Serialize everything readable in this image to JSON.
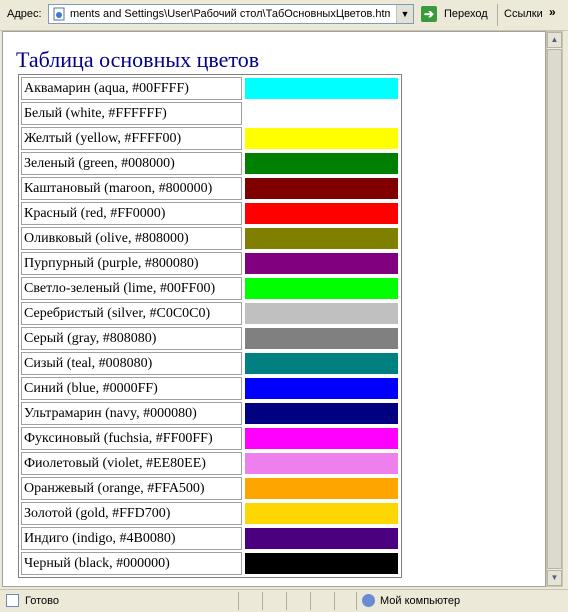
{
  "address_bar": {
    "label": "Адрес:",
    "value": "ments and Settings\\User\\Рабочий стол\\ТабОсновныхЦветов.htm",
    "go_label": "Переход",
    "links_label": "Ссылки",
    "more": "»"
  },
  "page": {
    "title": "Таблица основных цветов"
  },
  "colors": [
    {
      "label": "Аквамарин (aqua, #00FFFF)",
      "hex": "#00FFFF"
    },
    {
      "label": "Белый (white, #FFFFFF)",
      "hex": "#FFFFFF"
    },
    {
      "label": "Желтый (yellow, #FFFF00)",
      "hex": "#FFFF00"
    },
    {
      "label": "Зеленый (green, #008000)",
      "hex": "#008000"
    },
    {
      "label": "Каштановый (maroon, #800000)",
      "hex": "#800000"
    },
    {
      "label": "Красный (red, #FF0000)",
      "hex": "#FF0000"
    },
    {
      "label": "Оливковый (olive, #808000)",
      "hex": "#808000"
    },
    {
      "label": "Пурпурный (purple, #800080)",
      "hex": "#800080"
    },
    {
      "label": "Светло-зеленый (lime, #00FF00)",
      "hex": "#00FF00"
    },
    {
      "label": "Серебристый (silver, #C0C0C0)",
      "hex": "#C0C0C0"
    },
    {
      "label": "Серый (gray, #808080)",
      "hex": "#808080"
    },
    {
      "label": "Сизый (teal, #008080)",
      "hex": "#008080"
    },
    {
      "label": "Синий (blue, #0000FF)",
      "hex": "#0000FF"
    },
    {
      "label": "Ультрамарин (navy, #000080)",
      "hex": "#000080"
    },
    {
      "label": "Фуксиновый (fuchsia, #FF00FF)",
      "hex": "#FF00FF"
    },
    {
      "label": "Фиолетовый (violet, #EE80EE)",
      "hex": "#EE80EE"
    },
    {
      "label": "Оранжевый (orange, #FFA500)",
      "hex": "#FFA500"
    },
    {
      "label": "Золотой (gold, #FFD700)",
      "hex": "#FFD700"
    },
    {
      "label": "Индиго (indigo, #4B0080)",
      "hex": "#4B0080"
    },
    {
      "label": "Черный (black, #000000)",
      "hex": "#000000"
    }
  ],
  "status_bar": {
    "text": "Готово",
    "zone": "Мой компьютер"
  },
  "icons": {
    "address_page": "ie-page-icon",
    "go": "go-arrow-icon",
    "status": "page-done-icon",
    "zone": "my-computer-icon"
  },
  "theme": {
    "title_color": "#00008B",
    "chrome_bg": "#ECE9D8"
  }
}
